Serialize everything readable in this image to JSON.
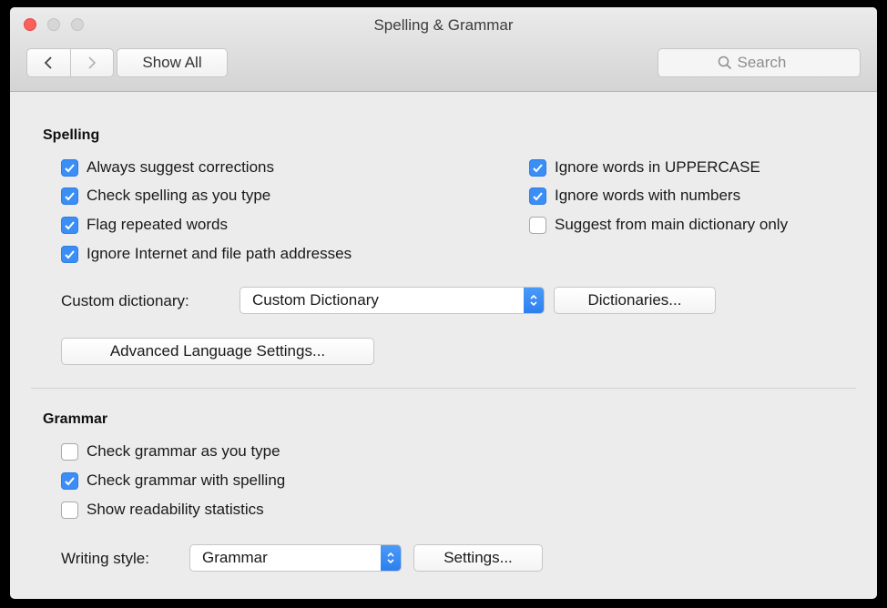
{
  "window": {
    "title": "Spelling & Grammar"
  },
  "toolbar": {
    "back_icon": "chevron-left-icon",
    "forward_icon": "chevron-right-icon",
    "show_all_label": "Show All",
    "search_placeholder": "Search",
    "search_value": ""
  },
  "spelling": {
    "heading": "Spelling",
    "options_left": [
      {
        "label": "Always suggest corrections",
        "checked": true
      },
      {
        "label": "Check spelling as you type",
        "checked": true
      },
      {
        "label": "Flag repeated words",
        "checked": true
      },
      {
        "label": "Ignore Internet and file path addresses",
        "checked": true
      }
    ],
    "options_right": [
      {
        "label": "Ignore words in UPPERCASE",
        "checked": true
      },
      {
        "label": "Ignore words with numbers",
        "checked": true
      },
      {
        "label": "Suggest from main dictionary only",
        "checked": false
      }
    ],
    "custom_dictionary_label": "Custom dictionary:",
    "custom_dictionary_value": "Custom Dictionary",
    "dictionaries_button": "Dictionaries...",
    "advanced_button": "Advanced Language Settings..."
  },
  "grammar": {
    "heading": "Grammar",
    "options": [
      {
        "label": "Check grammar as you type",
        "checked": false
      },
      {
        "label": "Check grammar with spelling",
        "checked": true
      },
      {
        "label": "Show readability statistics",
        "checked": false
      }
    ],
    "writing_style_label": "Writing style:",
    "writing_style_value": "Grammar",
    "settings_button": "Settings..."
  },
  "colors": {
    "accent": "#3a8ef6",
    "close_button": "#fc605c"
  }
}
